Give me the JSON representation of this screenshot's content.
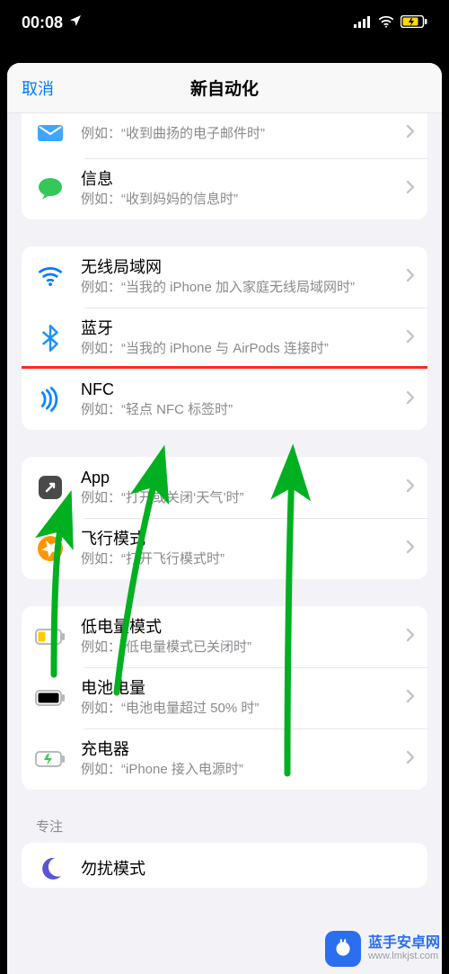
{
  "status": {
    "time": "00:08",
    "location_icon": "location-arrow",
    "signal_icon": "signal-bars",
    "wifi_icon": "wifi",
    "battery_icon": "battery-charging"
  },
  "sheet": {
    "cancel": "取消",
    "title": "新自动化"
  },
  "groups": [
    {
      "rows": [
        {
          "icon": "mail",
          "icon_color": "#3ea6ff",
          "title": "",
          "subtitle": "例如：“收到曲扬的电子邮件时”"
        },
        {
          "icon": "message",
          "icon_color": "#34c759",
          "title": "信息",
          "subtitle": "例如：“收到妈妈的信息时”"
        }
      ]
    },
    {
      "rows": [
        {
          "icon": "wifi",
          "icon_color": "#007aff",
          "title": "无线局域网",
          "subtitle": "例如：“当我的 iPhone 加入家庭无线局域网时”"
        },
        {
          "icon": "bluetooth",
          "icon_color": "#1e90ff",
          "title": "蓝牙",
          "subtitle": "例如：“当我的 iPhone 与 AirPods 连接时”"
        },
        {
          "icon": "nfc",
          "icon_color": "#0a84ff",
          "title": "NFC",
          "subtitle": "例如：“轻点 NFC 标签时”",
          "highlight": true
        }
      ]
    },
    {
      "rows": [
        {
          "icon": "app",
          "icon_color": "#4a4a4a",
          "title": "App",
          "subtitle": "例如：“打开或关闭‘天气’时”"
        },
        {
          "icon": "airplane",
          "icon_color": "#ff9500",
          "title": "飞行模式",
          "subtitle": "例如：“打开飞行模式时”"
        }
      ]
    },
    {
      "rows": [
        {
          "icon": "low-power",
          "icon_color": "#ffcc00",
          "title": "低电量模式",
          "subtitle": "例如：“低电量模式已关闭时”"
        },
        {
          "icon": "battery",
          "icon_color": "#000000",
          "title": "电池电量",
          "subtitle": "例如：“电池电量超过 50% 时”"
        },
        {
          "icon": "charger",
          "icon_color": "#34c759",
          "title": "充电器",
          "subtitle": "例如：“iPhone 接入电源时”"
        }
      ]
    }
  ],
  "focus_section_label": "专注",
  "focus_row": {
    "icon": "moon",
    "icon_color": "#5856d6",
    "title": "勿扰模式",
    "subtitle": ""
  },
  "watermark": {
    "line1": "蓝手安卓网",
    "line2": "www.lmkjst.com"
  },
  "colors": {
    "accent": "#007aff",
    "highlight_border": "#ff2a1a",
    "arrow": "#00b020"
  }
}
